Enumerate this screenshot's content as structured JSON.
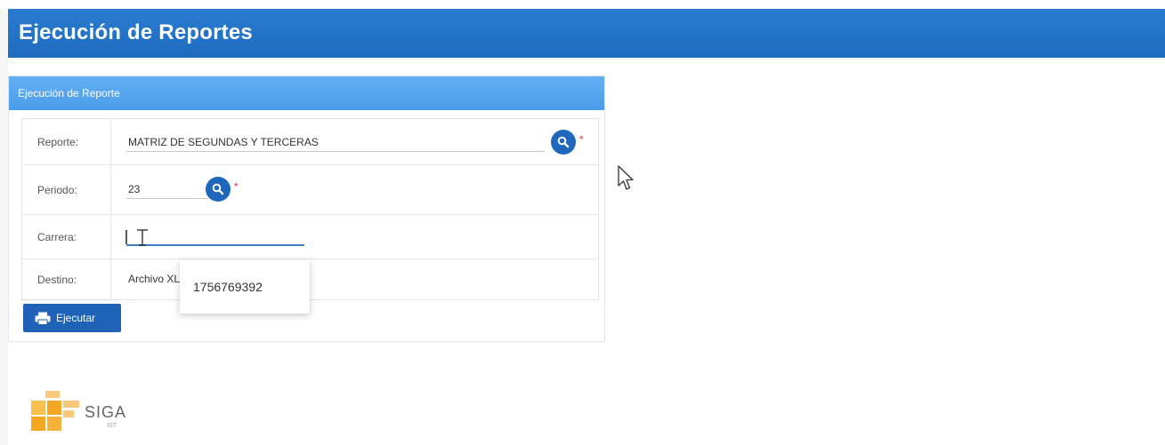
{
  "page": {
    "title": "Ejecución de Reportes"
  },
  "panel": {
    "title": "Ejecución de Reporte"
  },
  "form": {
    "reporte": {
      "label": "Reporte:",
      "value": "MATRIZ DE SEGUNDAS Y TERCERAS",
      "required": "*"
    },
    "periodo": {
      "label": "Periodo:",
      "value": "23",
      "required": "*"
    },
    "carrera": {
      "label": "Carrera:",
      "value": ""
    },
    "destino": {
      "label": "Destino:",
      "value": "Archivo XL"
    }
  },
  "autocomplete": {
    "option": "1756769392"
  },
  "actions": {
    "execute_label": "Ejecutar"
  },
  "logo": {
    "text": "SIGA",
    "sub": "IST"
  },
  "colors": {
    "header": "#1e6cc0",
    "panel_header": "#4a9be9",
    "button": "#1f63b8",
    "logo_orange": "#f5a623"
  },
  "icons": {
    "search": "search-icon",
    "print": "print-icon",
    "cursor": "mouse-cursor-icon"
  }
}
